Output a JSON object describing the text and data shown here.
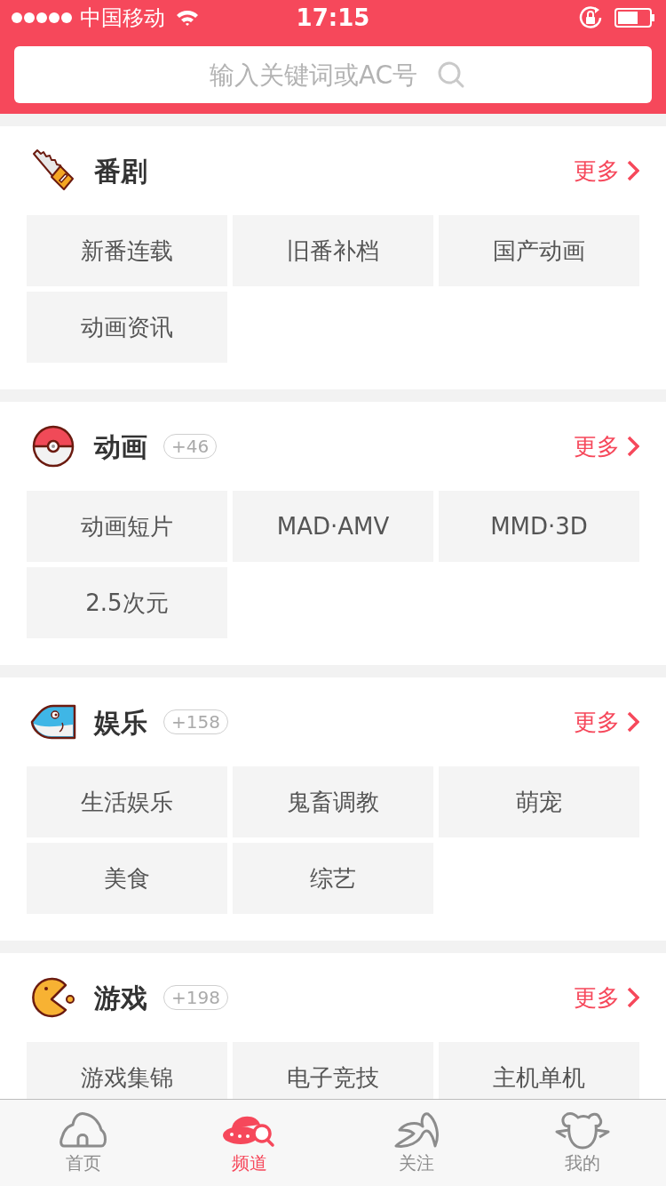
{
  "status_bar": {
    "carrier": "中国移动",
    "time": "17:15"
  },
  "search": {
    "placeholder": "输入关键词或AC号"
  },
  "sections": [
    {
      "title": "番剧",
      "more": "更多",
      "items": [
        "新番连载",
        "旧番补档",
        "国产动画",
        "动画资讯"
      ]
    },
    {
      "title": "动画",
      "count": "+46",
      "more": "更多",
      "items": [
        "动画短片",
        "MAD·AMV",
        "MMD·3D",
        "2.5次元"
      ]
    },
    {
      "title": "娱乐",
      "count": "+158",
      "more": "更多",
      "items": [
        "生活娱乐",
        "鬼畜调教",
        "萌宠",
        "美食",
        "综艺"
      ]
    },
    {
      "title": "游戏",
      "count": "+198",
      "more": "更多",
      "items": [
        "游戏集锦",
        "电子竞技",
        "主机单机"
      ]
    }
  ],
  "tab_bar": [
    {
      "label": "首页",
      "selected": false
    },
    {
      "label": "频道",
      "selected": true
    },
    {
      "label": "关注",
      "selected": false
    },
    {
      "label": "我的",
      "selected": false
    }
  ]
}
